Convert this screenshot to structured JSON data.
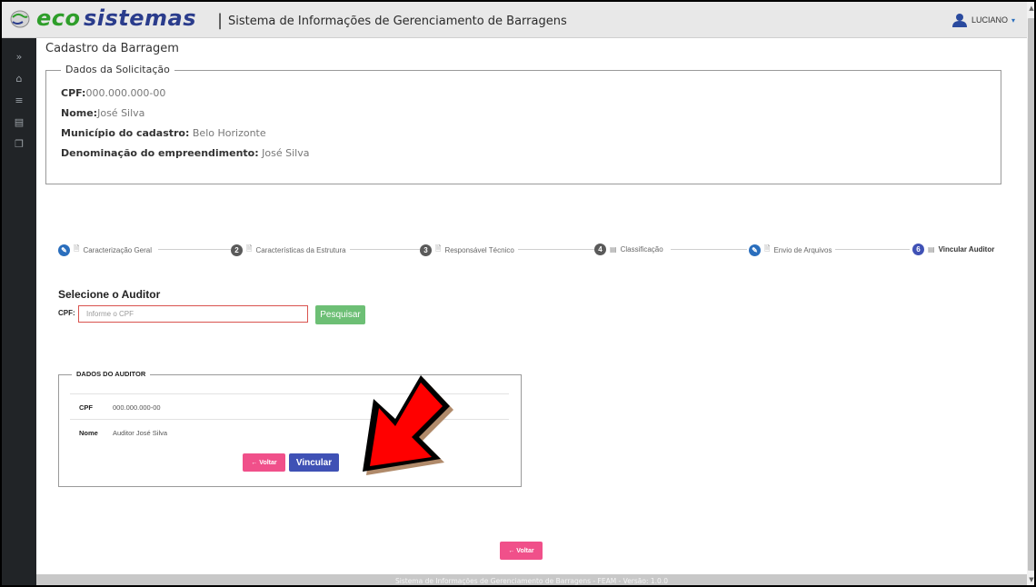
{
  "header": {
    "brand_eco": "eco",
    "brand_sys": "sistemas",
    "separator": "|",
    "title": "Sistema de Informações de Gerenciamento de Barragens",
    "user_name": "LUCIANO",
    "user_caret": "▾"
  },
  "sidebar": {
    "items": [
      {
        "icon": "expand-icon",
        "glyph": "»"
      },
      {
        "icon": "home-icon",
        "glyph": "⌂"
      },
      {
        "icon": "menu-icon",
        "glyph": "≡"
      },
      {
        "icon": "id-card-icon",
        "glyph": "▤"
      },
      {
        "icon": "copy-icon",
        "glyph": "❐"
      }
    ]
  },
  "page": {
    "title": "Cadastro da Barragem"
  },
  "solicitacao": {
    "legend": "Dados da Solicitação",
    "cpf_label": "CPF:",
    "cpf_value": "000.000.000-00",
    "nome_label": "Nome:",
    "nome_value": "José Silva",
    "municipio_label": "Município do cadastro:",
    "municipio_value": " Belo Horizonte",
    "denominacao_label": "Denominação do empreendimento:",
    "denominacao_value": " José Silva"
  },
  "stepper": {
    "steps": [
      {
        "marker": "✎",
        "label": "Caracterização Geral",
        "state": "edited"
      },
      {
        "marker": "2",
        "label": "Características da Estrutura",
        "state": "pending"
      },
      {
        "marker": "3",
        "label": "Responsável Técnico",
        "state": "pending"
      },
      {
        "marker": "4",
        "label": "Classificação",
        "state": "pending"
      },
      {
        "marker": "✎",
        "label": "Envio de Arquivos",
        "state": "edited"
      },
      {
        "marker": "6",
        "label": "Vincular Auditor",
        "state": "active"
      }
    ]
  },
  "search": {
    "title": "Selecione o Auditor",
    "cpf_label": "CPF:",
    "cpf_placeholder": "Informe o CPF",
    "button_label": "Pesquisar"
  },
  "auditor": {
    "legend": "DADOS DO AUDITOR",
    "rows": [
      {
        "key": "CPF",
        "value": "000.000.000-00"
      },
      {
        "key": "Nome",
        "value": "Auditor José Silva"
      }
    ],
    "voltar_label": "← Voltar",
    "vincular_label": "Vincular"
  },
  "bottom": {
    "voltar_label": "← Voltar"
  },
  "footer": {
    "text": "Sistema de Informações de Gerenciamento de Barragens - FEAM - Versão: 1.0.0"
  },
  "colors": {
    "eco_green": "#2e9e2a",
    "sys_blue": "#2a3c8c",
    "sidebar_bg": "#212427",
    "step_edited": "#2a6ebd",
    "step_pending": "#5a5a5a",
    "step_active": "#3f51b5",
    "pesquisar_green": "#6dbf75",
    "voltar_pink": "#f0508a",
    "vincular_blue": "#3f51b5",
    "arrow_red": "#ff0000"
  }
}
